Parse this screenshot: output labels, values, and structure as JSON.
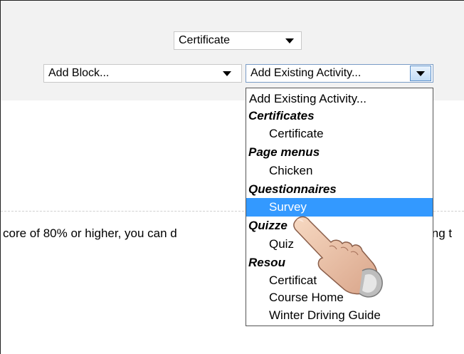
{
  "toolbar": {
    "certificate_select": "Certificate",
    "add_block_select": "Add Block...",
    "add_activity_select": "Add Existing Activity..."
  },
  "content": {
    "text_left": "core of 80% or higher, you can d",
    "text_right": "ing t"
  },
  "dropdown": {
    "first": "Add Existing Activity...",
    "groups": [
      {
        "label": "Certificates",
        "items": [
          "Certificate"
        ]
      },
      {
        "label": "Page menus",
        "items": [
          "Chicken"
        ]
      },
      {
        "label": "Questionnaires",
        "items": [
          "Survey"
        ]
      },
      {
        "label": "Quizzes",
        "items": [
          "Quiz"
        ]
      },
      {
        "label": "Resources",
        "items": [
          "Certificate",
          "Course Home",
          "Winter Driving Guide"
        ]
      }
    ],
    "selected": "Survey",
    "visible_group_text": {
      "quizzes": "Quizze",
      "resources": "Resou"
    },
    "visible_item_text": {
      "resource_certificate": "Certificat"
    }
  },
  "colors": {
    "selection": "#3399ff",
    "topband": "#f2f2f2"
  },
  "icons": {
    "pointer": "hand-pointer-icon",
    "dropdown": "chevron-down-icon"
  }
}
